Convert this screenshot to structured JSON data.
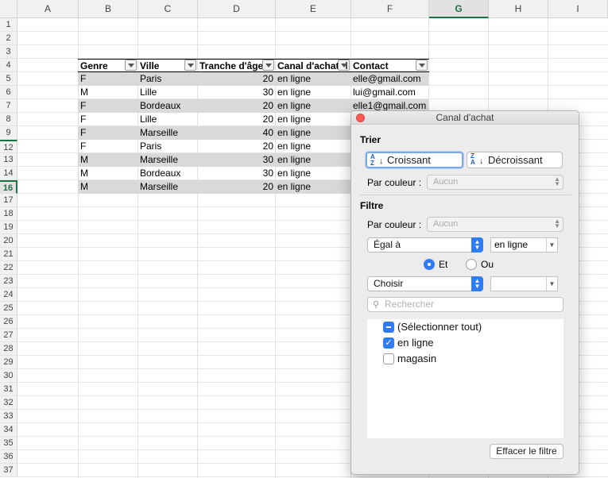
{
  "columns": [
    "A",
    "B",
    "C",
    "D",
    "E",
    "F",
    "G",
    "H",
    "I"
  ],
  "selected_column": "G",
  "rows": [
    "1",
    "2",
    "3",
    "4",
    "5",
    "6",
    "7",
    "8",
    "9",
    "12",
    "13",
    "14",
    "16",
    "17",
    "18",
    "19",
    "20",
    "21",
    "22",
    "23",
    "24",
    "25",
    "26",
    "27",
    "28",
    "29",
    "30",
    "31",
    "32",
    "33",
    "34",
    "35",
    "36",
    "37"
  ],
  "selected_row": "16",
  "table": {
    "headers": [
      "Genre",
      "Ville",
      "Tranche d'âge",
      "Canal d'achat",
      "Contact"
    ],
    "rows": [
      [
        "F",
        "Paris",
        "20",
        "en ligne",
        "elle@gmail.com"
      ],
      [
        "M",
        "Lille",
        "30",
        "en ligne",
        "lui@gmail.com"
      ],
      [
        "F",
        "Bordeaux",
        "20",
        "en ligne",
        "elle1@gmail.com"
      ],
      [
        "F",
        "Lille",
        "20",
        "en ligne",
        ""
      ],
      [
        "F",
        "Marseille",
        "40",
        "en ligne",
        ""
      ],
      [
        "F",
        "Paris",
        "20",
        "en ligne",
        ""
      ],
      [
        "M",
        "Marseille",
        "30",
        "en ligne",
        ""
      ],
      [
        "M",
        "Bordeaux",
        "30",
        "en ligne",
        ""
      ],
      [
        "M",
        "Marseille",
        "20",
        "en ligne",
        ""
      ]
    ]
  },
  "popover": {
    "title": "Canal d'achat",
    "sort": {
      "section": "Trier",
      "ascending": "Croissant",
      "descending": "Décroissant",
      "by_color_label": "Par couleur :",
      "by_color_value": "Aucun"
    },
    "filter": {
      "section": "Filtre",
      "by_color_label": "Par couleur :",
      "by_color_value": "Aucun",
      "condition1": "Égal à",
      "value1": "en ligne",
      "and_label": "Et",
      "or_label": "Ou",
      "condition2": "Choisir",
      "value2": "",
      "search_placeholder": "Rechercher",
      "items": [
        "(Sélectionner tout)",
        "en ligne",
        "magasin"
      ],
      "clear_button": "Effacer le filtre"
    }
  },
  "colors": {
    "accent": "#2e7cf6",
    "excel_green": "#1e7145",
    "stripe": "#d9d9d9"
  },
  "icons": [
    "close-icon",
    "sort-ascending-icon",
    "sort-descending-icon",
    "filter-dropdown-icon",
    "search-icon",
    "checkmark-icon"
  ]
}
